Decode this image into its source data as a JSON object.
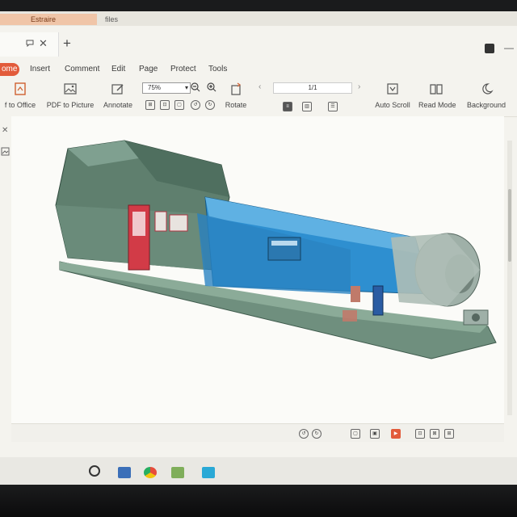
{
  "window": {
    "external_tabs": [
      "Estraire",
      "files"
    ]
  },
  "menu": {
    "items": [
      "ome",
      "Insert",
      "Comment",
      "Edit",
      "Page",
      "Protect",
      "Tools"
    ]
  },
  "toolbar": {
    "to_office": "f to Office",
    "pdf_to_picture": "PDF to Picture",
    "annotate": "Annotate",
    "zoom_value": "75%",
    "rotate": "Rotate",
    "page_indicator": "1/1",
    "auto_scroll": "Auto Scroll",
    "read_mode": "Read Mode",
    "background": "Background"
  },
  "colors": {
    "accent": "#e25b3b",
    "model_blue": "#2e8fd0",
    "model_green": "#5a8a76",
    "model_gray": "#9fb0a8",
    "model_red": "#d23b47"
  }
}
